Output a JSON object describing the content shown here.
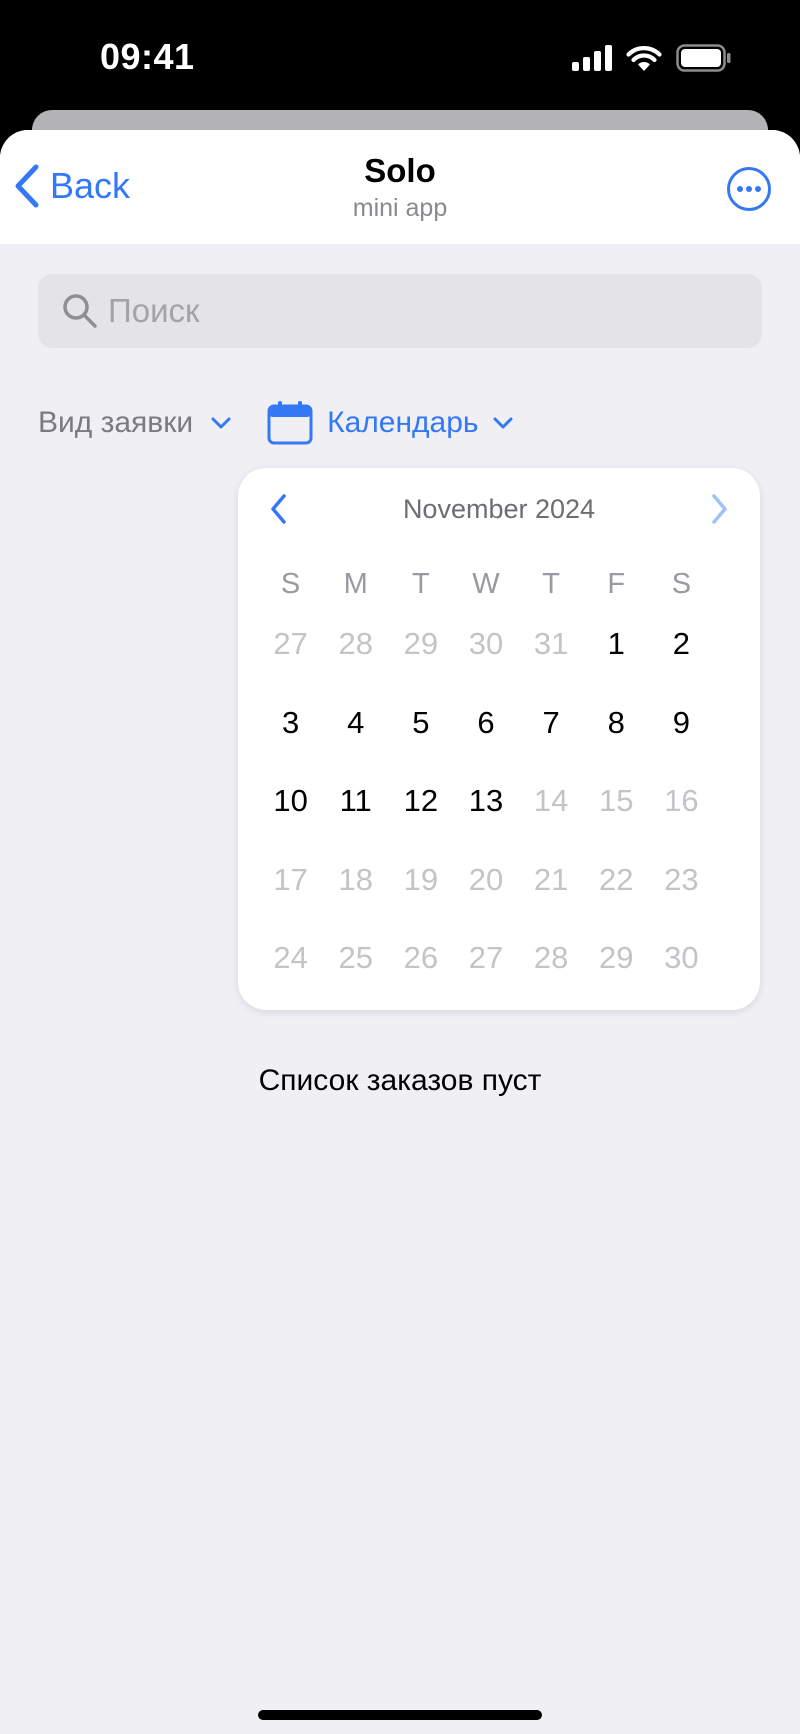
{
  "status_bar": {
    "time": "09:41"
  },
  "nav": {
    "back_label": "Back",
    "title": "Solo",
    "subtitle": "mini app"
  },
  "search": {
    "placeholder": "Поиск",
    "value": ""
  },
  "filters": {
    "type_label": "Вид заявки",
    "calendar_label": "Календарь"
  },
  "calendar": {
    "month_label": "November 2024",
    "weekdays": [
      "S",
      "M",
      "T",
      "W",
      "T",
      "F",
      "S"
    ],
    "days": [
      {
        "d": "27",
        "m": true
      },
      {
        "d": "28",
        "m": true
      },
      {
        "d": "29",
        "m": true
      },
      {
        "d": "30",
        "m": true
      },
      {
        "d": "31",
        "m": true
      },
      {
        "d": "1",
        "m": false
      },
      {
        "d": "2",
        "m": false
      },
      {
        "d": "3",
        "m": false
      },
      {
        "d": "4",
        "m": false
      },
      {
        "d": "5",
        "m": false
      },
      {
        "d": "6",
        "m": false
      },
      {
        "d": "7",
        "m": false
      },
      {
        "d": "8",
        "m": false
      },
      {
        "d": "9",
        "m": false
      },
      {
        "d": "10",
        "m": false
      },
      {
        "d": "11",
        "m": false
      },
      {
        "d": "12",
        "m": false
      },
      {
        "d": "13",
        "m": false
      },
      {
        "d": "14",
        "m": true
      },
      {
        "d": "15",
        "m": true
      },
      {
        "d": "16",
        "m": true
      },
      {
        "d": "17",
        "m": true
      },
      {
        "d": "18",
        "m": true
      },
      {
        "d": "19",
        "m": true
      },
      {
        "d": "20",
        "m": true
      },
      {
        "d": "21",
        "m": true
      },
      {
        "d": "22",
        "m": true
      },
      {
        "d": "23",
        "m": true
      },
      {
        "d": "24",
        "m": true
      },
      {
        "d": "25",
        "m": true
      },
      {
        "d": "26",
        "m": true
      },
      {
        "d": "27",
        "m": true
      },
      {
        "d": "28",
        "m": true
      },
      {
        "d": "29",
        "m": true
      },
      {
        "d": "30",
        "m": true
      }
    ]
  },
  "empty_message": "Список заказов пуст",
  "colors": {
    "accent": "#3478f6",
    "background": "#efeff4",
    "muted_day": "#c4c4c8"
  },
  "icons": {
    "back": "chevron-left-icon",
    "more": "ellipsis-circle-icon",
    "search": "search-icon",
    "calendar": "calendar-icon",
    "dropdown": "chevron-down-icon",
    "prev": "chevron-left-icon",
    "next": "chevron-right-icon"
  }
}
